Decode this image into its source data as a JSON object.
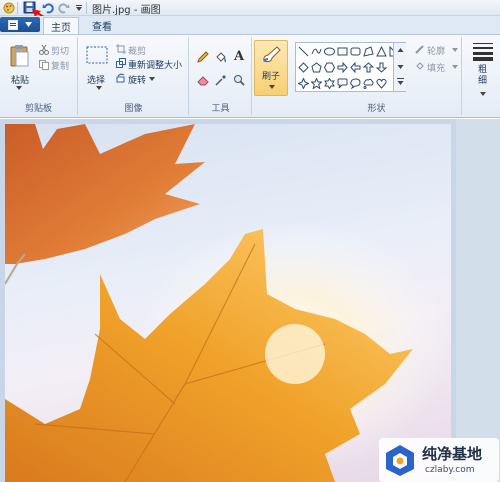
{
  "window": {
    "title": "图片.jpg - 画图"
  },
  "tabs": [
    {
      "label": "主页"
    },
    {
      "label": "查看"
    }
  ],
  "clipboard": {
    "paste": "粘贴",
    "cut": "剪切",
    "copy": "复制",
    "group": "剪贴板"
  },
  "image": {
    "select": "选择",
    "crop": "裁剪",
    "resize": "重新调整大小",
    "rotate": "旋转",
    "group": "图像"
  },
  "tools": {
    "group": "工具",
    "text_tool": "A"
  },
  "brushes": {
    "label": "刷子"
  },
  "shapes": {
    "outline": "轮廓",
    "fill": "填充",
    "group": "形状"
  },
  "size": {
    "label": "粗细"
  },
  "watermark": {
    "title": "纯净基地",
    "url": "czlaby.com"
  }
}
